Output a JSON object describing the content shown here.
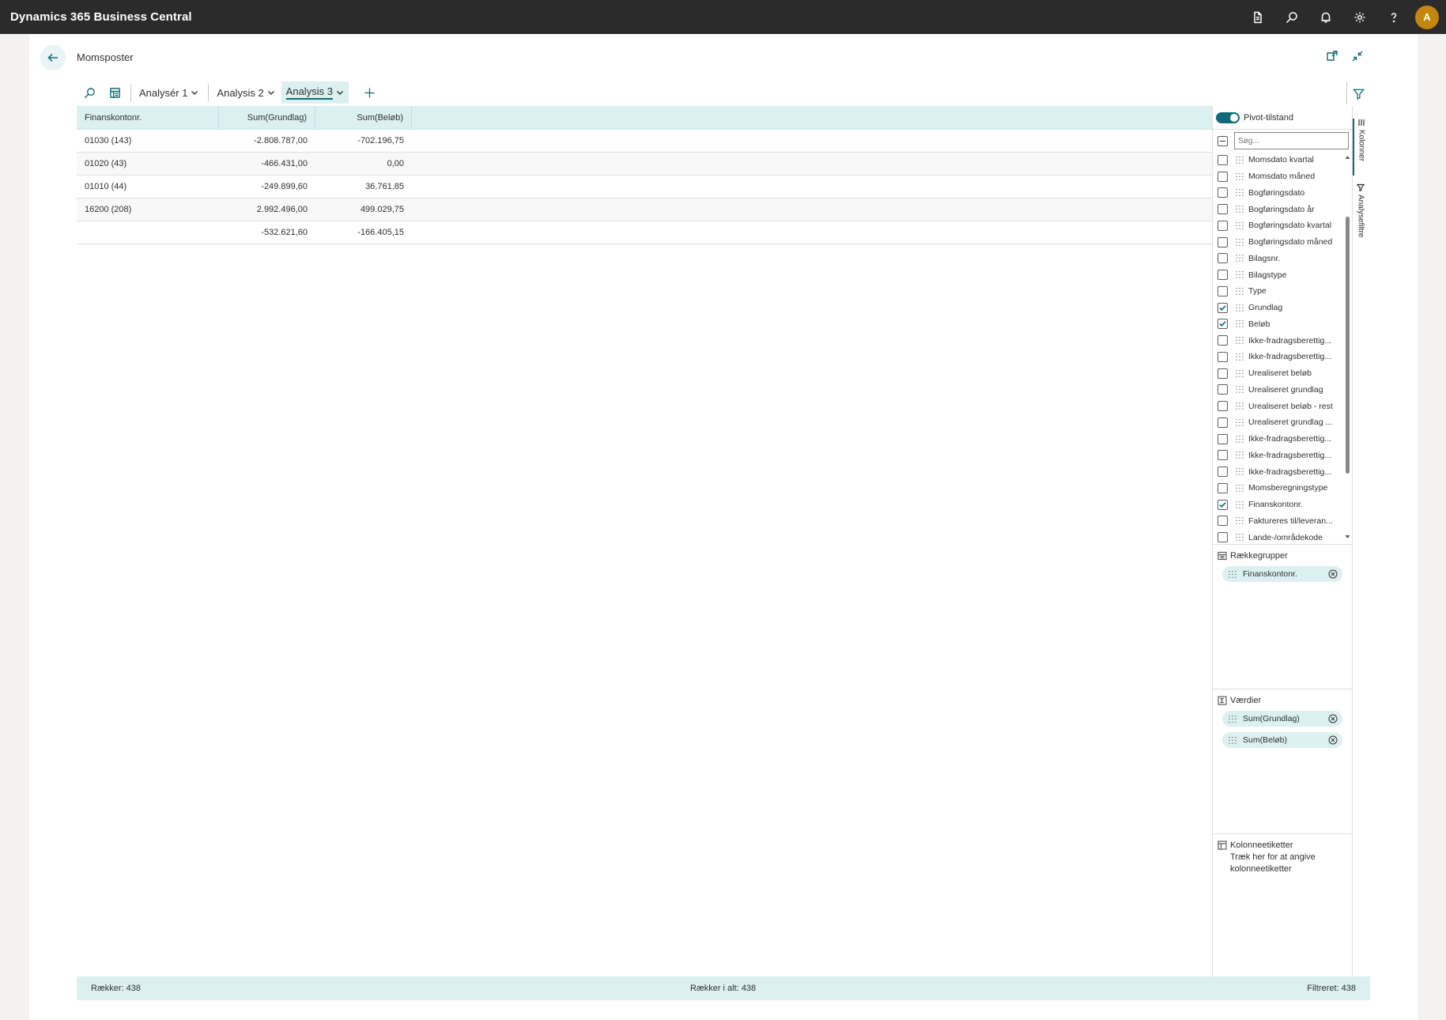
{
  "app": {
    "title": "Dynamics 365 Business Central",
    "avatar_initial": "A"
  },
  "page": {
    "title": "Momsposter"
  },
  "tabs": [
    {
      "label": "Analysér 1"
    },
    {
      "label": "Analysis 2"
    },
    {
      "label": "Analysis 3"
    }
  ],
  "grid": {
    "headers": [
      "Finanskontonr.",
      "Sum(Grundlag)",
      "Sum(Beløb)"
    ],
    "rows": [
      [
        "01030 (143)",
        "-2.808.787,00",
        "-702.196,75"
      ],
      [
        "01020 (43)",
        "-466.431,00",
        "0,00"
      ],
      [
        "01010 (44)",
        "-249.899,60",
        "36.761,85"
      ],
      [
        "16200 (208)",
        "2.992.496,00",
        "499.029,75"
      ],
      [
        "",
        "-532.621,60",
        "-166.405,15"
      ]
    ]
  },
  "side": {
    "pivot_label": "Pivot-tilstand",
    "search_placeholder": "Søg...",
    "columns": [
      {
        "label": "Momsdato kvartal",
        "checked": false
      },
      {
        "label": "Momsdato måned",
        "checked": false
      },
      {
        "label": "Bogføringsdato",
        "checked": false
      },
      {
        "label": "Bogføringsdato år",
        "checked": false
      },
      {
        "label": "Bogføringsdato kvartal",
        "checked": false
      },
      {
        "label": "Bogføringsdato måned",
        "checked": false
      },
      {
        "label": "Bilagsnr.",
        "checked": false
      },
      {
        "label": "Bilagstype",
        "checked": false
      },
      {
        "label": "Type",
        "checked": false
      },
      {
        "label": "Grundlag",
        "checked": true
      },
      {
        "label": "Beløb",
        "checked": true
      },
      {
        "label": "Ikke-fradragsberettig...",
        "checked": false
      },
      {
        "label": "Ikke-fradragsberettig...",
        "checked": false
      },
      {
        "label": "Urealiseret beløb",
        "checked": false
      },
      {
        "label": "Urealiseret grundlag",
        "checked": false
      },
      {
        "label": "Urealiseret beløb - rest",
        "checked": false
      },
      {
        "label": "Urealiseret grundlag ...",
        "checked": false
      },
      {
        "label": "Ikke-fradragsberettig...",
        "checked": false
      },
      {
        "label": "Ikke-fradragsberettig...",
        "checked": false
      },
      {
        "label": "Ikke-fradragsberettig...",
        "checked": false
      },
      {
        "label": "Momsberegningstype",
        "checked": false
      },
      {
        "label": "Finanskontonr.",
        "checked": true
      },
      {
        "label": "Faktureres til/leveran...",
        "checked": false
      },
      {
        "label": "Lande-/områdekode",
        "checked": false
      }
    ],
    "row_groups": {
      "title": "Rækkegrupper",
      "items": [
        "Finanskontonr."
      ]
    },
    "values": {
      "title": "Værdier",
      "items": [
        "Sum(Grundlag)",
        "Sum(Beløb)"
      ]
    },
    "column_labels": {
      "title": "Kolonneetiketter",
      "hint": "Træk her for at angive kolonneetiketter"
    },
    "vtabs": [
      "Kolonner",
      "Analysefiltre"
    ]
  },
  "status": {
    "rows_label": "Rækker:",
    "rows_value": "438",
    "total_label": "Rækker i alt:",
    "total_value": "438",
    "filtered_label": "Filtreret:",
    "filtered_value": "438"
  },
  "colors": {
    "accent": "#0f6b76",
    "header_bg": "#dceff1",
    "appbar_bg": "#2b2b2b",
    "avatar_bg": "#c4860f"
  }
}
